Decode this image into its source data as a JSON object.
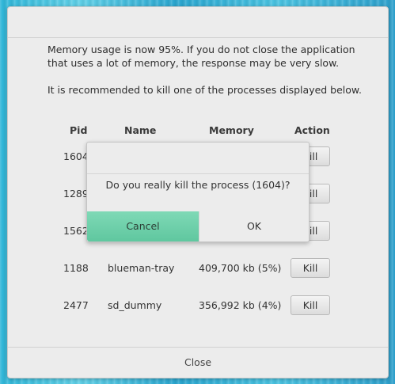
{
  "message": {
    "line1": "Memory usage is now 95%. If you do not close the application that uses a lot of memory, the response may be very slow.",
    "line2": "It is recommended to kill one of the processes displayed below."
  },
  "table": {
    "headers": [
      "Pid",
      "Name",
      "Memory",
      "Action"
    ],
    "rows": [
      {
        "pid": "1604",
        "name": "",
        "memory": "",
        "action": "Kill"
      },
      {
        "pid": "1289",
        "name": "",
        "memory": "",
        "action": "Kill"
      },
      {
        "pid": "1562",
        "name": "",
        "memory": "",
        "action": "Kill"
      },
      {
        "pid": "1188",
        "name": "blueman-tray",
        "memory": "409,700 kb (5%)",
        "action": "Kill"
      },
      {
        "pid": "2477",
        "name": "sd_dummy",
        "memory": "356,992 kb (4%)",
        "action": "Kill"
      }
    ]
  },
  "footer": {
    "close_label": "Close"
  },
  "dialog": {
    "message": "Do you really kill the process (1604)?",
    "cancel_label": "Cancel",
    "ok_label": "OK"
  }
}
